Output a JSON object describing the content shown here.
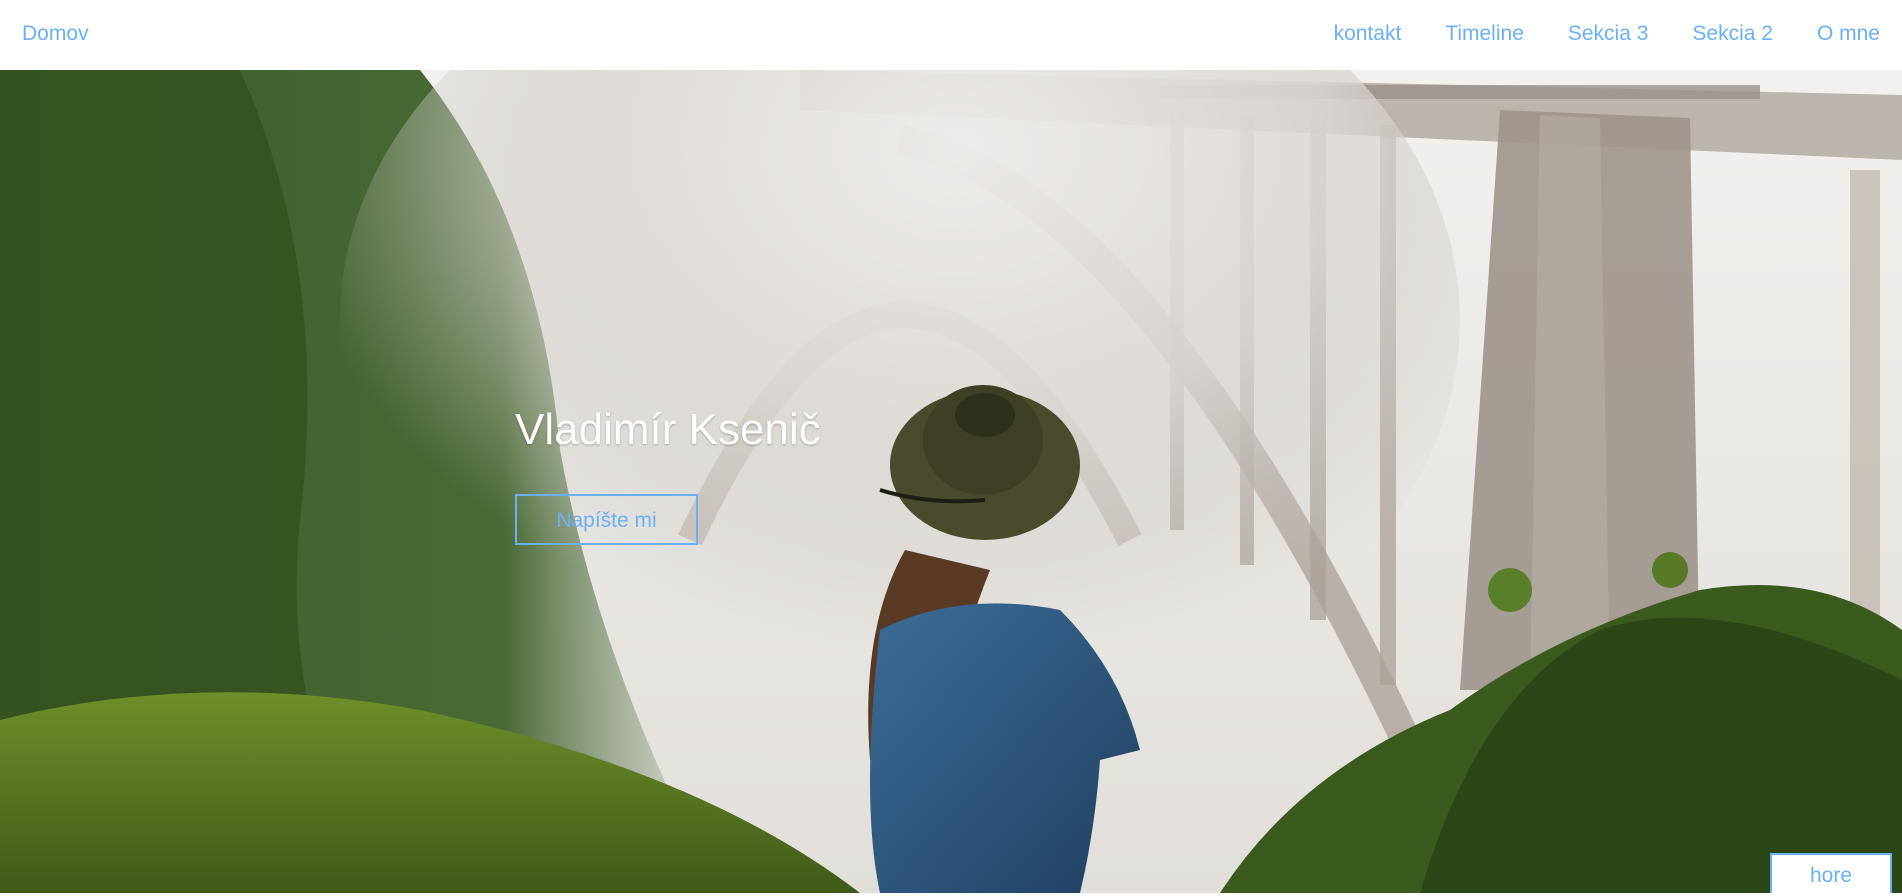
{
  "nav": {
    "brand": "Domov",
    "items": [
      {
        "label": "kontakt"
      },
      {
        "label": "Timeline"
      },
      {
        "label": "Sekcia 3"
      },
      {
        "label": "Sekcia 2"
      },
      {
        "label": "O mne"
      }
    ]
  },
  "hero": {
    "title": "Vladimír Ksenič",
    "cta_label": "Napíšte mi"
  },
  "back_to_top": {
    "label": "hore"
  },
  "colors": {
    "accent": "#6bb0f5",
    "nav_background": "#ffffff",
    "hero_text": "#ffffff"
  }
}
